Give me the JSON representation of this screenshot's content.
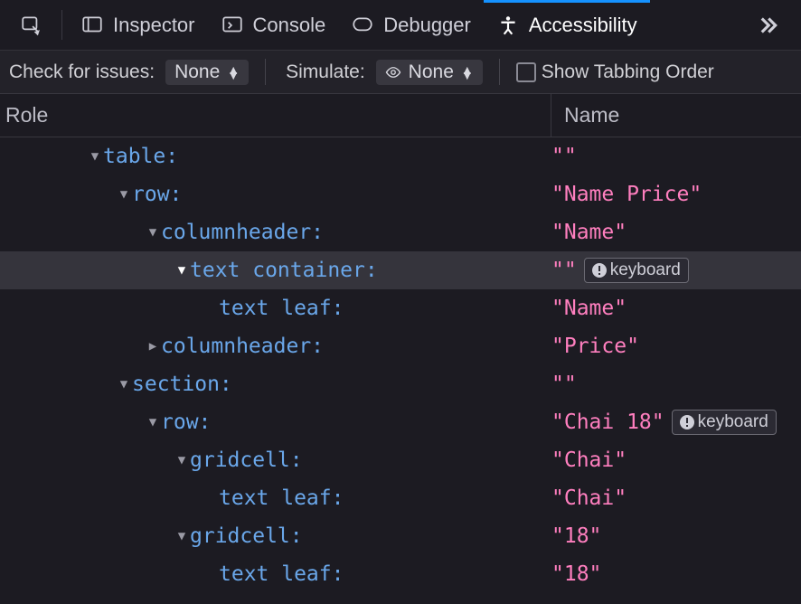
{
  "tabs": {
    "inspector": "Inspector",
    "console": "Console",
    "debugger": "Debugger",
    "accessibility": "Accessibility"
  },
  "toolbar": {
    "check_label": "Check for issues:",
    "check_value": "None",
    "simulate_label": "Simulate:",
    "simulate_value": "None",
    "tabbing_label": "Show Tabbing Order"
  },
  "columns": {
    "role": "Role",
    "name": "Name"
  },
  "badge": {
    "keyboard": "keyboard"
  },
  "tree": {
    "r0": {
      "indent": 3,
      "twisty": "down",
      "role": "table:",
      "name": "\"\""
    },
    "r1": {
      "indent": 4,
      "twisty": "down",
      "role": "row:",
      "name": "\"Name Price\""
    },
    "r2": {
      "indent": 5,
      "twisty": "down",
      "role": "columnheader:",
      "name": "\"Name\""
    },
    "r3": {
      "indent": 6,
      "twisty": "down-solid",
      "role": "text container:",
      "name": "\"\""
    },
    "r4": {
      "indent": 7,
      "twisty": "",
      "role": "text leaf:",
      "name": "\"Name\""
    },
    "r5": {
      "indent": 5,
      "twisty": "right",
      "role": "columnheader:",
      "name": "\"Price\""
    },
    "r6": {
      "indent": 4,
      "twisty": "down",
      "role": "section:",
      "name": "\"\""
    },
    "r7": {
      "indent": 5,
      "twisty": "down",
      "role": "row:",
      "name": "\"Chai 18\""
    },
    "r8": {
      "indent": 6,
      "twisty": "down",
      "role": "gridcell:",
      "name": "\"Chai\""
    },
    "r9": {
      "indent": 7,
      "twisty": "",
      "role": "text leaf:",
      "name": "\"Chai\""
    },
    "r10": {
      "indent": 6,
      "twisty": "down",
      "role": "gridcell:",
      "name": "\"18\""
    },
    "r11": {
      "indent": 7,
      "twisty": "",
      "role": "text leaf:",
      "name": "\"18\""
    }
  }
}
